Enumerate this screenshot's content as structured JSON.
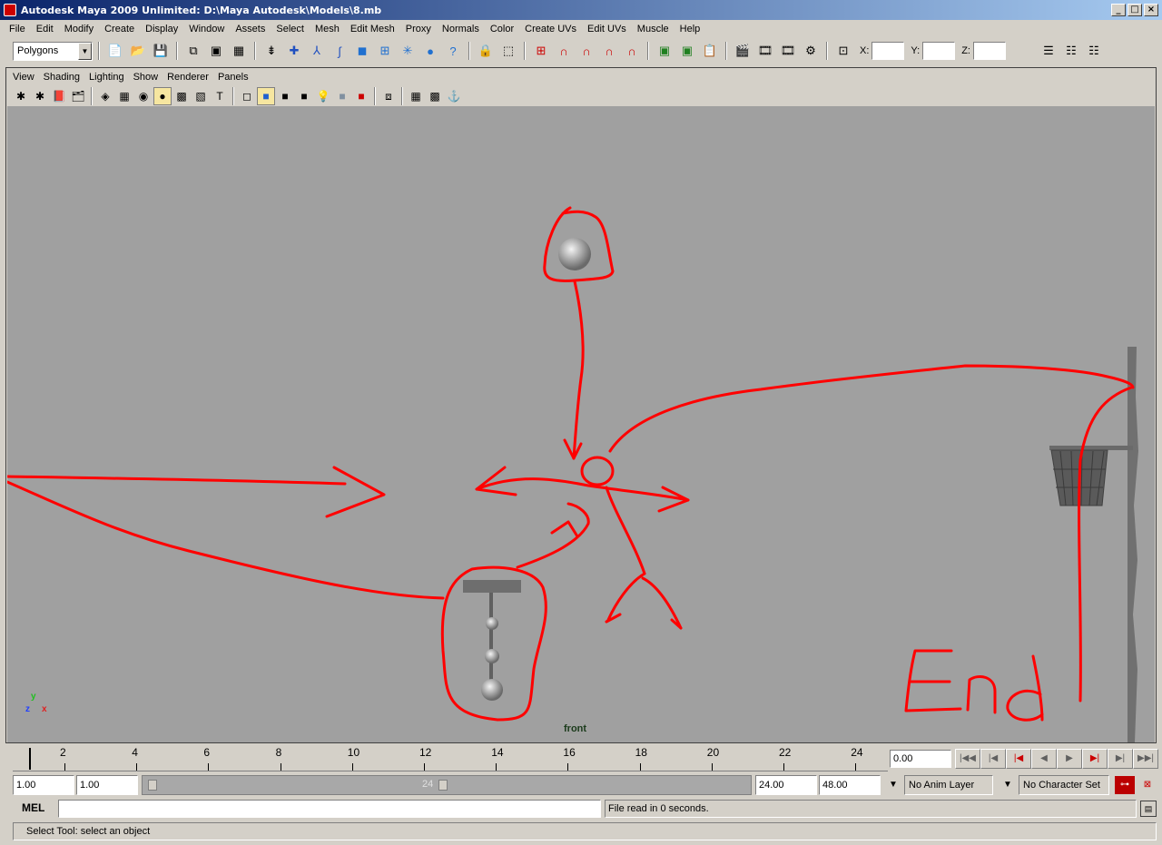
{
  "window": {
    "title": "Autodesk Maya 2009 Unlimited: D:\\Maya Autodesk\\Models\\8.mb",
    "minimize": "_",
    "maximize": "□",
    "close": "×"
  },
  "menubar": [
    "File",
    "Edit",
    "Modify",
    "Create",
    "Display",
    "Window",
    "Assets",
    "Select",
    "Mesh",
    "Edit Mesh",
    "Proxy",
    "Normals",
    "Color",
    "Create UVs",
    "Edit UVs",
    "Muscle",
    "Help"
  ],
  "status_line": {
    "menu_set": "Polygons",
    "x_label": "X:",
    "y_label": "Y:",
    "z_label": "Z:",
    "x_value": "",
    "y_value": "",
    "z_value": ""
  },
  "panel": {
    "menus": [
      "View",
      "Shading",
      "Lighting",
      "Show",
      "Renderer",
      "Panels"
    ],
    "camera": "front",
    "axis": {
      "y": "y",
      "z": "z",
      "x": "x"
    }
  },
  "annotation_text": "End",
  "time_slider": {
    "ticks": [
      "2",
      "4",
      "6",
      "8",
      "10",
      "12",
      "14",
      "16",
      "18",
      "20",
      "22",
      "24"
    ],
    "current_time": "0.00"
  },
  "range_slider": {
    "start_time": "1.00",
    "range_start": "1.00",
    "range_end": "24.00",
    "end_time": "48.00",
    "inner_label": "24",
    "anim_layer": "No Anim Layer",
    "character_set": "No Character Set"
  },
  "command_line": {
    "label": "MEL",
    "input": "",
    "result": "File read in 0 seconds."
  },
  "help_line": "Select Tool: select an object",
  "colors": {
    "viewport": "#a0a0a0",
    "annotation": "#ff0000",
    "ui": "#d4d0c8",
    "title_bar": "#0a246a"
  }
}
